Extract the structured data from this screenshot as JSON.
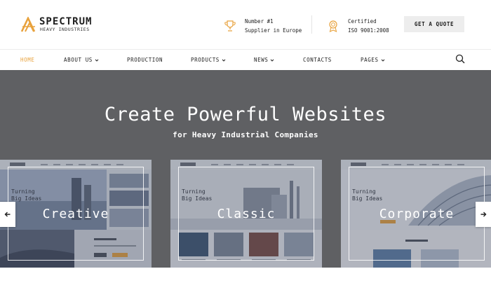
{
  "brand": {
    "name": "SPECTRUM",
    "tagline": "HEAVY INDUSTRIES",
    "accent": "#e8a23d"
  },
  "header": {
    "info": [
      {
        "icon": "trophy-icon",
        "line1": "Number #1",
        "line2": "Supplier in Europe"
      },
      {
        "icon": "award-badge-icon",
        "line1": "Certified",
        "line2": "ISO 9001:2008"
      }
    ],
    "quote_button": "GET A QUOTE"
  },
  "nav": {
    "items": [
      {
        "label": "HOME",
        "active": true,
        "dropdown": false
      },
      {
        "label": "ABOUT US",
        "active": false,
        "dropdown": true
      },
      {
        "label": "PRODUCTION",
        "active": false,
        "dropdown": false
      },
      {
        "label": "PRODUCTS",
        "active": false,
        "dropdown": true
      },
      {
        "label": "NEWS",
        "active": false,
        "dropdown": true
      },
      {
        "label": "CONTACTS",
        "active": false,
        "dropdown": false
      },
      {
        "label": "PAGES",
        "active": false,
        "dropdown": true
      }
    ],
    "search_icon": "search-icon"
  },
  "hero": {
    "title": "Create Powerful Websites",
    "subtitle": "for Heavy Industrial Companies",
    "background": "#5f6063"
  },
  "demos": [
    {
      "label": "Creative",
      "preview_text": "Turning\nBig Ideas"
    },
    {
      "label": "Classic",
      "preview_text": "Turning\nBig Ideas"
    },
    {
      "label": "Corporate",
      "preview_text": "Turning\nBig Ideas"
    }
  ],
  "carousel": {
    "prev_icon": "arrow-left-icon",
    "next_icon": "arrow-right-icon"
  }
}
